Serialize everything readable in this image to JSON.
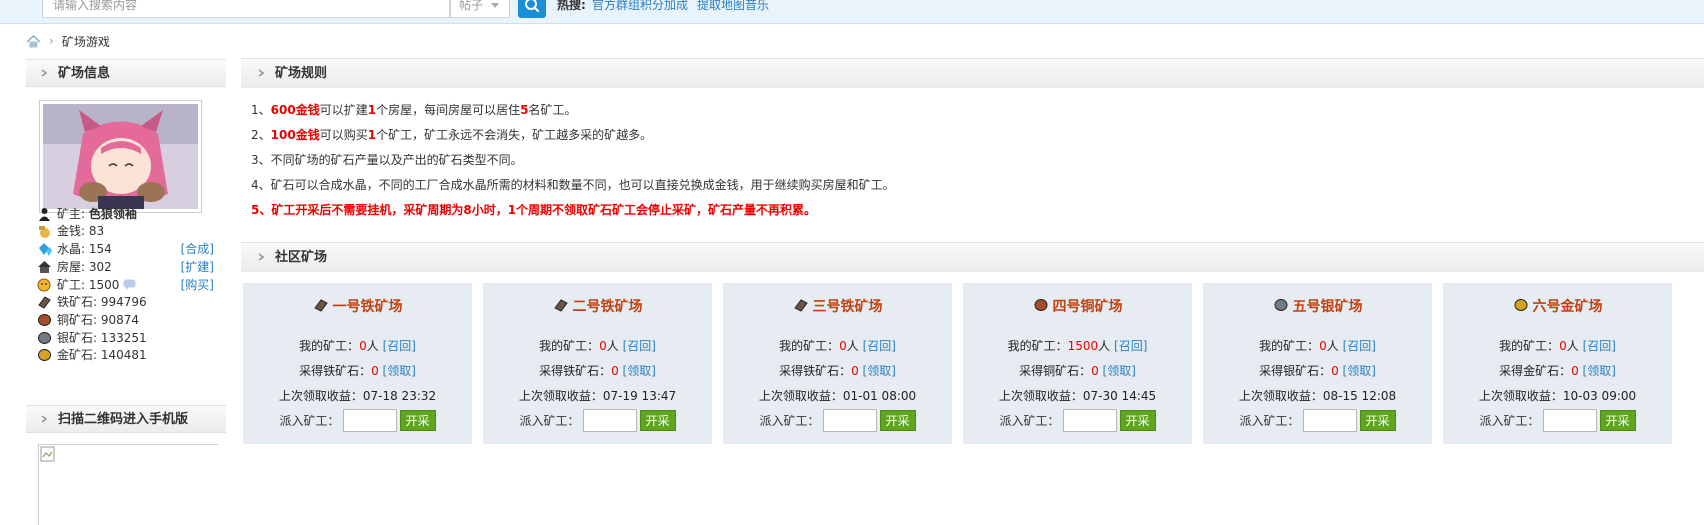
{
  "topbar": {
    "search_placeholder": "请输入搜索内容",
    "search_type": "帖子",
    "hot_label": "热搜:",
    "hot_links": [
      "官方群组积分加成",
      "提取地图音乐"
    ]
  },
  "breadcrumb": {
    "current": "矿场游戏"
  },
  "sidebar": {
    "mine_info_title": "矿场信息",
    "stats": [
      {
        "icon": "user-icon",
        "label": "矿主:",
        "value": "色狼领袖"
      },
      {
        "icon": "money-bag-icon",
        "label": "金钱:",
        "value": "83"
      },
      {
        "icon": "crystal-icon",
        "label": "水晶:",
        "value": "154",
        "action": "[合成]"
      },
      {
        "icon": "house-icon",
        "label": "房屋:",
        "value": "302",
        "action": "[扩建]"
      },
      {
        "icon": "miner-icon",
        "label": "矿工:",
        "value": "1500",
        "action": "[购买]"
      },
      {
        "icon": "iron-ore-icon",
        "label": "铁矿石:",
        "value": "994796"
      },
      {
        "icon": "copper-ore-icon",
        "label": "铜矿石:",
        "value": "90874"
      },
      {
        "icon": "silver-ore-icon",
        "label": "银矿石:",
        "value": "133251"
      },
      {
        "icon": "gold-ore-icon",
        "label": "金矿石:",
        "value": "140481"
      }
    ],
    "qr_title": "扫描二维码进入手机版"
  },
  "rules": {
    "title": "矿场规则",
    "r1": {
      "n": "1、",
      "a": "600金钱",
      "b": "可以扩建",
      "c": "1",
      "d": "个房屋，每间房屋可以居住",
      "e": "5",
      "f": "名矿工。"
    },
    "r2": {
      "n": "2、",
      "a": "100金钱",
      "b": "可以购买",
      "c": "1",
      "d": "个矿工，矿工永远不会消失，矿工越多采的矿越多。"
    },
    "r3": "3、不同矿场的矿石产量以及产出的矿石类型不同。",
    "r4": "4、矿石可以合成水晶，不同的工厂合成水晶所需的材料和数量不同，也可以直接兑换成金钱，用于继续购买房屋和矿工。",
    "r5": "5、矿工开采后不需要挂机，采矿周期为8小时，1个周期不领取矿石矿工会停止采矿，矿石产量不再积累。"
  },
  "mines": {
    "title": "社区矿场",
    "labels": {
      "my_miners": "我的矿工：",
      "person": "人",
      "recall": "[召回]",
      "collect": "[领取]",
      "last_collect": "上次领取收益：",
      "dispatch": "派入矿工：",
      "start": "开采"
    },
    "items": [
      {
        "name": "一号铁矿场",
        "icon": "iron-ore-icon",
        "miners": "0",
        "ore_label": "采得铁矿石：",
        "ore": "0",
        "last": "07-18 23:32"
      },
      {
        "name": "二号铁矿场",
        "icon": "iron-ore-icon",
        "miners": "0",
        "ore_label": "采得铁矿石：",
        "ore": "0",
        "last": "07-19 13:47"
      },
      {
        "name": "三号铁矿场",
        "icon": "iron-ore-icon",
        "miners": "0",
        "ore_label": "采得铁矿石：",
        "ore": "0",
        "last": "01-01 08:00"
      },
      {
        "name": "四号铜矿场",
        "icon": "copper-ore-icon",
        "miners": "1500",
        "ore_label": "采得铜矿石：",
        "ore": "0",
        "last": "07-30 14:45"
      },
      {
        "name": "五号银矿场",
        "icon": "silver-ore-icon",
        "miners": "0",
        "ore_label": "采得银矿石：",
        "ore": "0",
        "last": "08-15 12:08"
      },
      {
        "name": "六号金矿场",
        "icon": "gold-ore-icon",
        "miners": "0",
        "ore_label": "采得金矿石：",
        "ore": "0",
        "last": "10-03 09:00"
      }
    ]
  }
}
